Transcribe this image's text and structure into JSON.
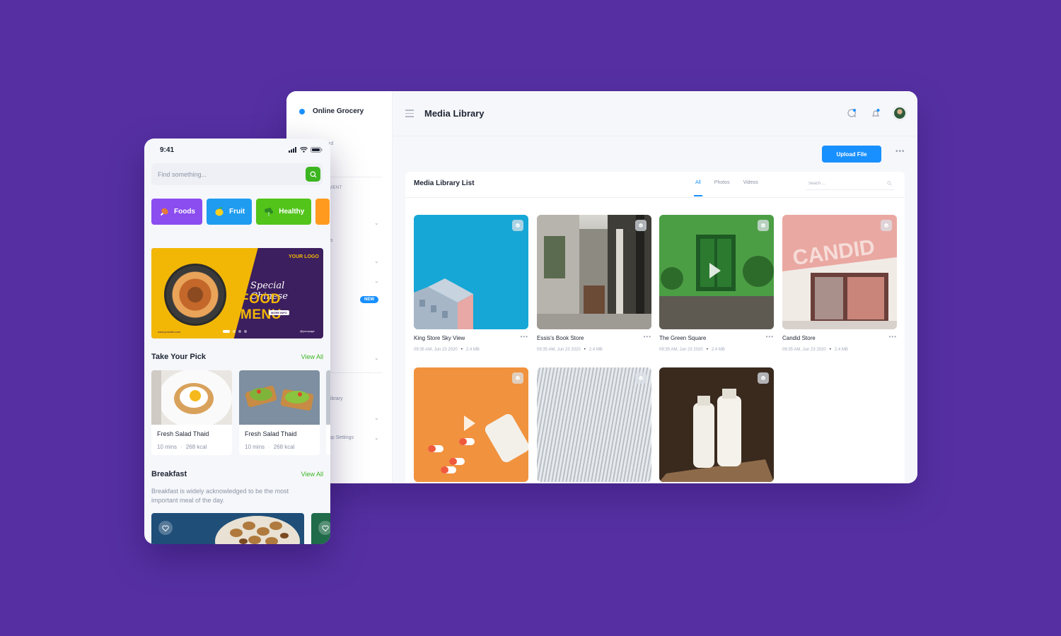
{
  "dashboard": {
    "brand": "Online Grocery",
    "page_title": "Media Library",
    "upload_label": "Upload File",
    "more_label": "•••",
    "sidebar_fragments": [
      "rd",
      "MENT",
      "s",
      "ibrary",
      "pp Settings"
    ],
    "new_badge": "NEW",
    "panel_title": "Media Library List",
    "tabs": [
      "All",
      "Photos",
      "Videos"
    ],
    "search_placeholder": "Seach ...",
    "items": [
      {
        "name": "King Store Sky View",
        "time": "09:35 AM, Jun 23 2020",
        "size": "2.4 MB"
      },
      {
        "name": "Essis's Book Store",
        "time": "09:35 AM, Jun 23 2020",
        "size": "2.4 MB"
      },
      {
        "name": "The Green Square",
        "time": "09:35 AM, Jun 23 2020",
        "size": "2.4 MB"
      },
      {
        "name": "Candid Store",
        "time": "09:35 AM, Jun 23 2020",
        "size": "2.4 MB"
      }
    ],
    "colors": {
      "primary": "#1890ff",
      "background": "#5630a3"
    }
  },
  "mobile": {
    "time": "9:41",
    "search_placeholder": "Find something...",
    "categories": [
      {
        "label": "Foods",
        "color": "#8b4cf0",
        "icon": "drumstick-icon"
      },
      {
        "label": "Fruit",
        "color": "#1f9cf0",
        "icon": "lemon-icon"
      },
      {
        "label": "Healthy",
        "color": "#52c41a",
        "icon": "broccoli-icon"
      }
    ],
    "banner": {
      "logo": "YOUR LOGO",
      "special": "Special Chinese",
      "menu": "FOOD MENU",
      "more": "MORE INFO",
      "site": "www.yoursite.com",
      "handle": "@yourpage"
    },
    "pick_title": "Take Your Pick",
    "view_all": "View All",
    "picks": [
      {
        "name": "Fresh Salad Thaid",
        "time": "10 mins",
        "kcal": "268 kcal"
      },
      {
        "name": "Fresh Salad Thaid",
        "time": "10 mins",
        "kcal": "268 kcal"
      }
    ],
    "breakfast_title": "Breakfast",
    "breakfast_desc": "Breakfast is widely acknowledged to be the most important meal of the day.",
    "accent": "#3cb521"
  }
}
